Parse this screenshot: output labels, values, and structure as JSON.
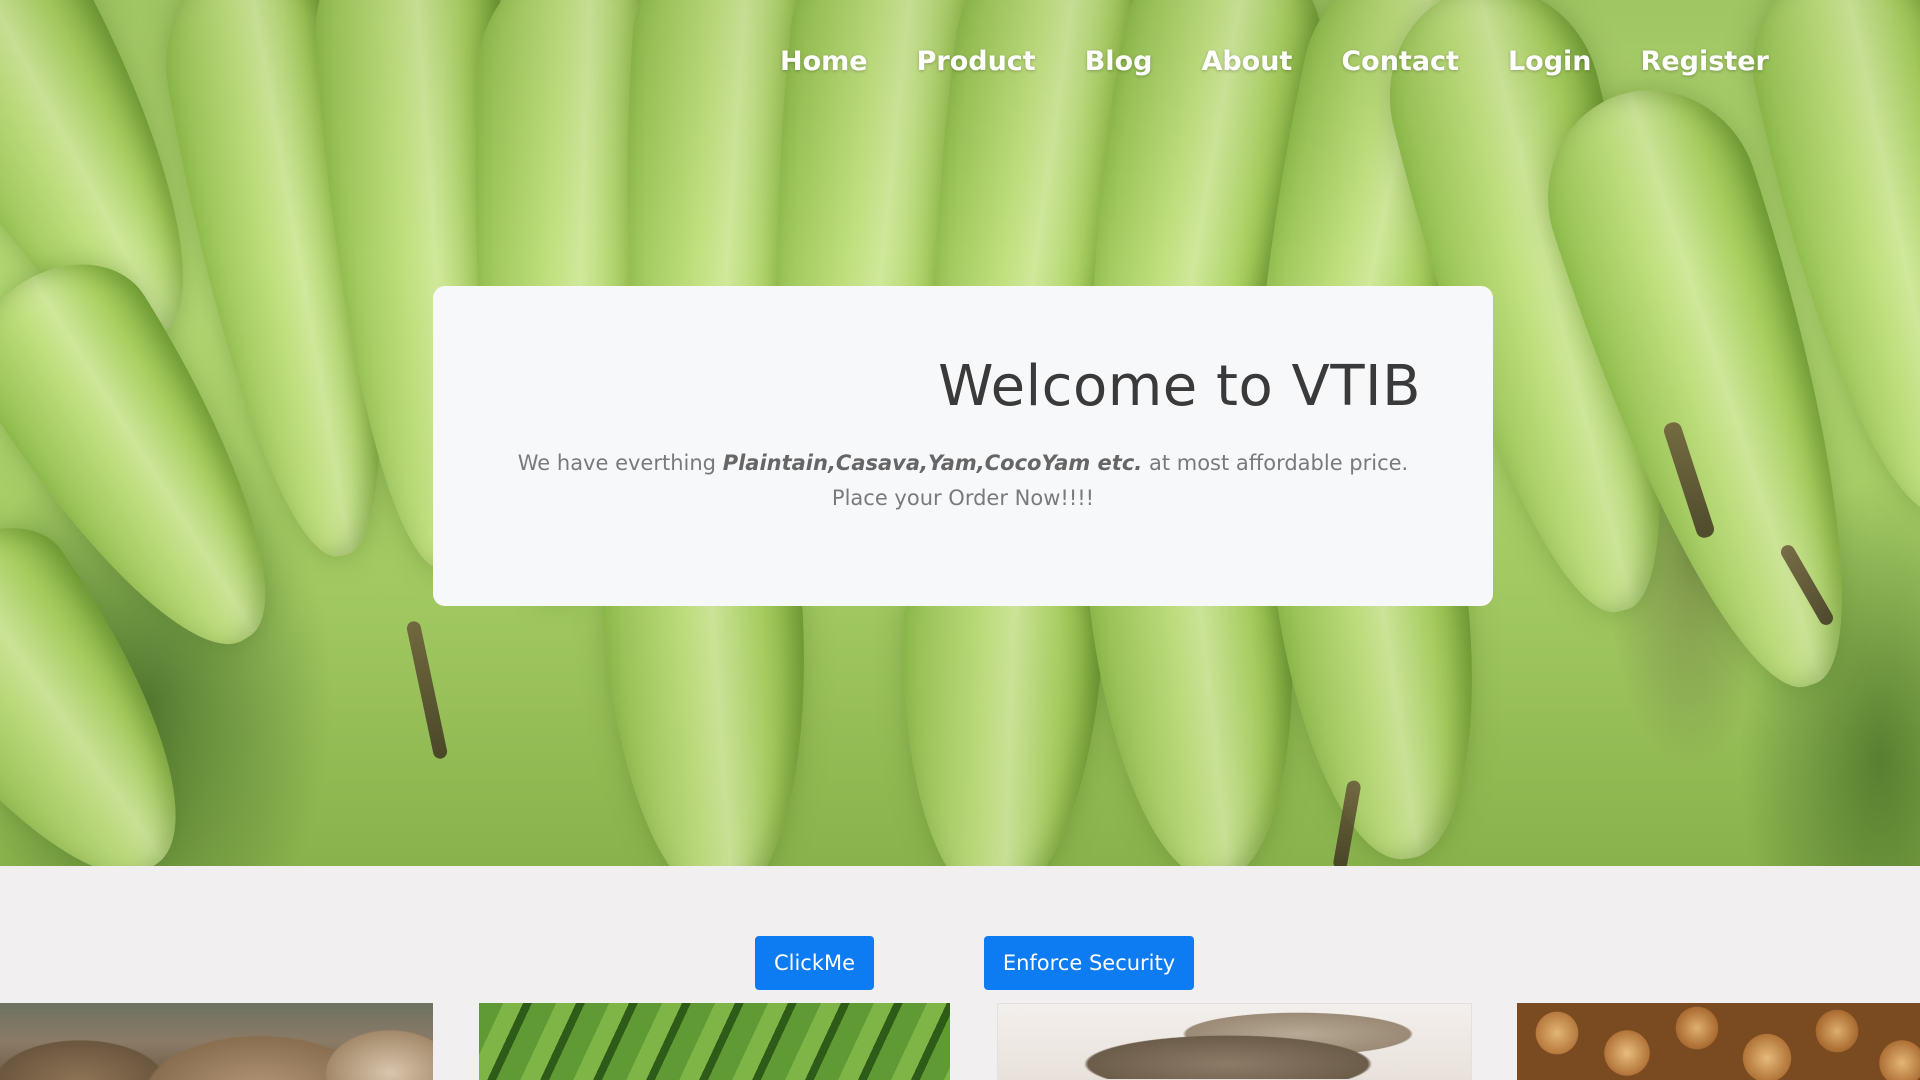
{
  "nav": {
    "items": [
      {
        "label": "Home"
      },
      {
        "label": "Product"
      },
      {
        "label": "Blog"
      },
      {
        "label": "About"
      },
      {
        "label": "Contact"
      },
      {
        "label": "Login"
      },
      {
        "label": "Register"
      }
    ]
  },
  "welcome": {
    "title": "Welcome to VTIB",
    "lead_prefix": "We have everthing ",
    "lead_products": "Plaintain,Casava,Yam,CocoYam etc.",
    "lead_suffix": " at most affordable price.",
    "lead_line2": "Place your Order Now!!!!"
  },
  "buttons": {
    "click_label": "ClickMe",
    "security_label": "Enforce Security"
  },
  "colors": {
    "button_bg": "#0d7bf2",
    "card_bg": "#f7f8fa",
    "section_bg": "#f1eff0"
  }
}
